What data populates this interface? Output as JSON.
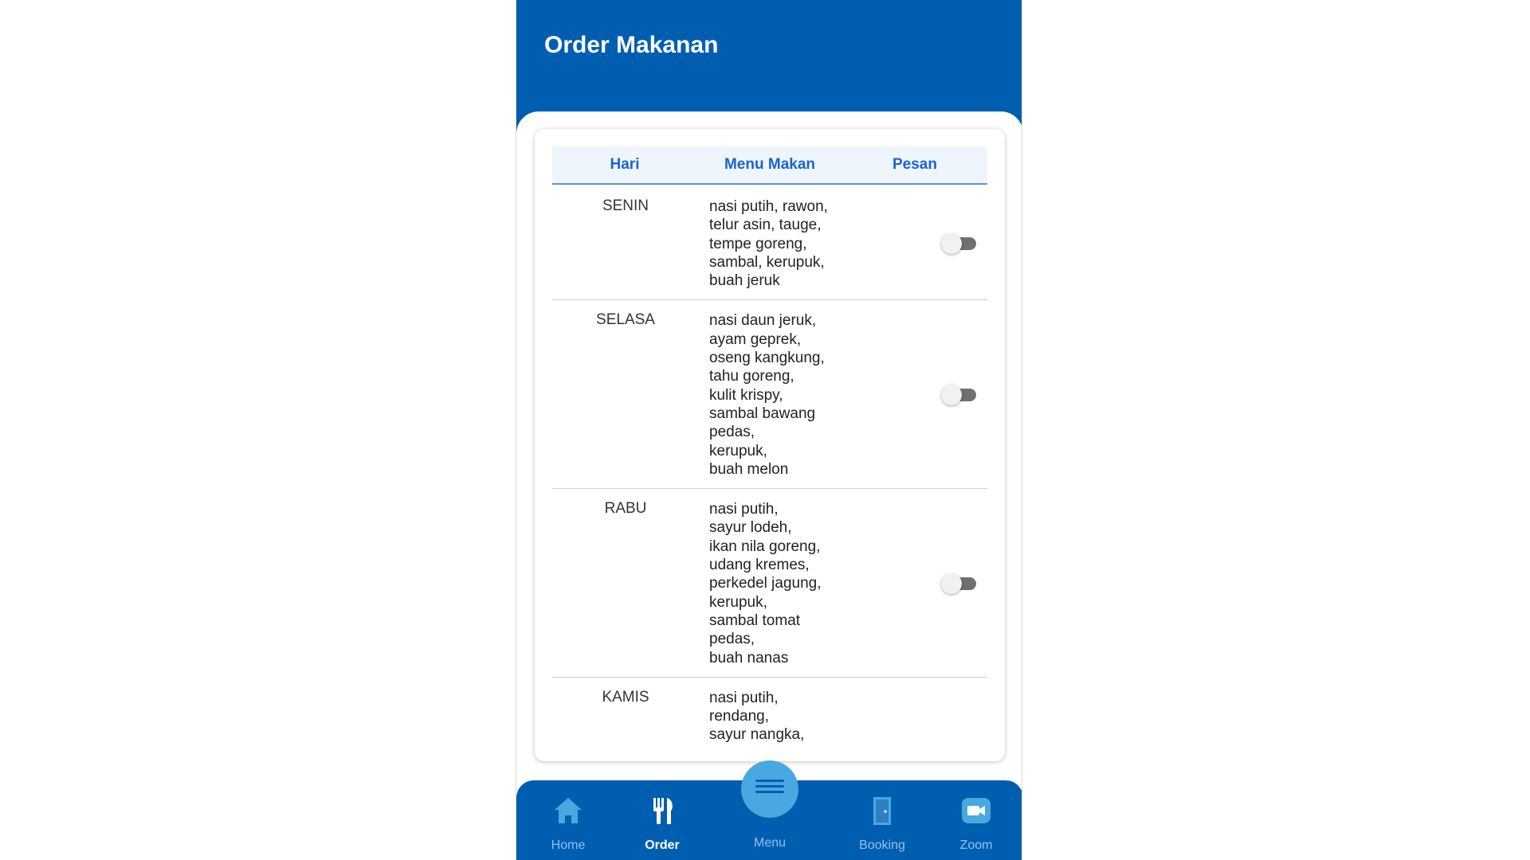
{
  "header": {
    "title": "Order Makanan"
  },
  "table": {
    "columns": [
      "Hari",
      "Menu Makan",
      "Pesan"
    ],
    "rows": [
      {
        "day": "SENIN",
        "menu": [
          "nasi putih, rawon,",
          "telur asin, tauge,",
          "tempe goreng,",
          "sambal, kerupuk,",
          "buah jeruk"
        ],
        "ordered": false
      },
      {
        "day": "SELASA",
        "menu": [
          "nasi daun jeruk,",
          "ayam geprek,",
          "oseng kangkung,",
          "tahu goreng,",
          "kulit krispy,",
          "sambal bawang",
          "pedas,",
          "kerupuk,",
          "buah melon"
        ],
        "ordered": false
      },
      {
        "day": "RABU",
        "menu": [
          "nasi putih,",
          "sayur lodeh,",
          "ikan nila goreng,",
          "udang kremes,",
          "perkedel jagung,",
          "kerupuk,",
          "sambal tomat",
          "pedas,",
          "buah nanas"
        ],
        "ordered": false
      },
      {
        "day": "KAMIS",
        "menu": [
          "nasi putih,",
          "rendang,",
          "sayur nangka,"
        ],
        "ordered": false
      }
    ]
  },
  "bottom_nav": {
    "items": [
      {
        "label": "Home",
        "icon": "home-icon",
        "active": false
      },
      {
        "label": "Order",
        "icon": "cutlery-icon",
        "active": true
      },
      {
        "label": "Menu",
        "icon": "hamburger-menu-icon",
        "active": false
      },
      {
        "label": "Booking",
        "icon": "door-icon",
        "active": false
      },
      {
        "label": "Zoom",
        "icon": "video-camera-icon",
        "active": false
      }
    ]
  },
  "colors": {
    "primary": "#005eb0",
    "accent": "#1a64d4",
    "nav_inactive": "#8fc2ef",
    "fab": "#4aa8e0"
  }
}
